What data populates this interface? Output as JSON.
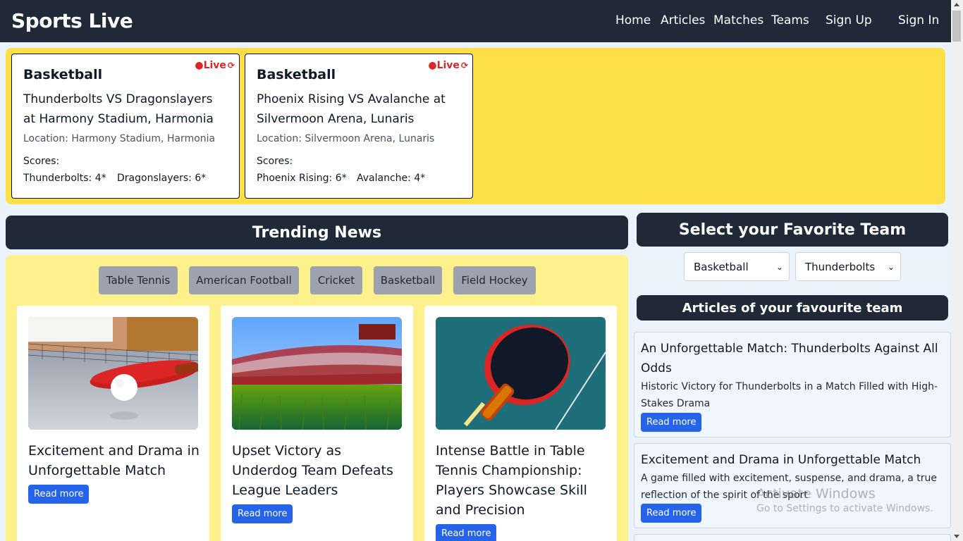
{
  "nav": {
    "brand": "Sports Live",
    "links": [
      "Home",
      "Articles",
      "Matches",
      "Teams",
      "Sign Up",
      "Sign In"
    ]
  },
  "live_matches": [
    {
      "sport": "Basketball",
      "live_label": "●Live",
      "refresh_icon": "⟳",
      "title": "Thunderbolts VS Dragonslayers at Harmony Stadium, Harmonia",
      "location": "Location: Harmony Stadium, Harmonia",
      "scores_label": "Scores:",
      "score_a": "Thunderbolts: 4*",
      "score_b": "Dragonslayers: 6*"
    },
    {
      "sport": "Basketball",
      "live_label": "●Live",
      "refresh_icon": "⟳",
      "title": "Phoenix Rising VS Avalanche at Silvermoon Arena, Lunaris",
      "location": "Location: Silvermoon Arena, Lunaris",
      "scores_label": "Scores:",
      "score_a": "Phoenix Rising: 6*",
      "score_b": "Avalanche: 4*"
    }
  ],
  "trending": {
    "title": "Trending News",
    "filters": [
      "Table Tennis",
      "American Football",
      "Cricket",
      "Basketball",
      "Field Hockey"
    ],
    "cards": [
      {
        "title": "Excitement and Drama in Unforgettable Match",
        "button": "Read more",
        "image": "table-tennis-paddle-net"
      },
      {
        "title": "Upset Victory as Underdog Team Defeats League Leaders",
        "button": "Read more",
        "image": "stadium-grass"
      },
      {
        "title": "Intense Battle in Table Tennis Championship: Players Showcase Skill and Precision",
        "button": "Read more",
        "image": "table-tennis-paddle-blue-table"
      }
    ]
  },
  "favorite": {
    "title": "Select your Favorite Team",
    "sport_select": "Basketball",
    "team_select": "Thunderbolts",
    "articles_title": "Articles of your favourite team",
    "articles": [
      {
        "title": "An Unforgettable Match: Thunderbolts Against All Odds",
        "description": "Historic Victory for Thunderbolts in a Match Filled with High-Stakes Drama",
        "button": "Read more"
      },
      {
        "title": "Excitement and Drama in Unforgettable Match",
        "description": "A game filled with excitement, suspense, and drama, a true reflection of the spirit of the sport",
        "button": "Read more"
      }
    ]
  },
  "watermark": {
    "line1": "Activate Windows",
    "line2": "Go to Settings to activate Windows."
  },
  "colors": {
    "nav_bg": "#1f2937",
    "live_bg": "#fde047",
    "news_bg": "#fef08a",
    "live_red": "#dc2626",
    "button_blue": "#2563eb",
    "filter_gray": "#9ca3af"
  }
}
